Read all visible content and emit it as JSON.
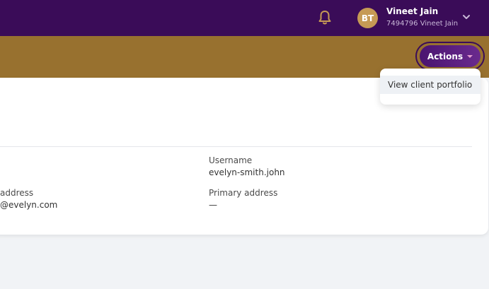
{
  "header": {
    "user": {
      "initials": "BT",
      "name": "Vineet Jain",
      "subtitle": "7494796 Vineet Jain"
    },
    "icons": {
      "notifications": "bell-icon",
      "user_menu": "chevron-down-icon"
    }
  },
  "subheader": {
    "actions_label": "Actions",
    "actions_menu": {
      "items": [
        {
          "label": "View client portfolio"
        }
      ]
    }
  },
  "details": {
    "username_label": "Username",
    "username_value": "evelyn-smith.john",
    "email_label_partial": "address",
    "email_value_partial": "@evelyn.com",
    "primary_address_label": "Primary address",
    "primary_address_value": "—"
  },
  "colors": {
    "topbar": "#3a0c58",
    "subbar": "#98712f",
    "accent_button": "#5a1f80",
    "avatar": "#c69a55",
    "bell": "#c69a55"
  }
}
